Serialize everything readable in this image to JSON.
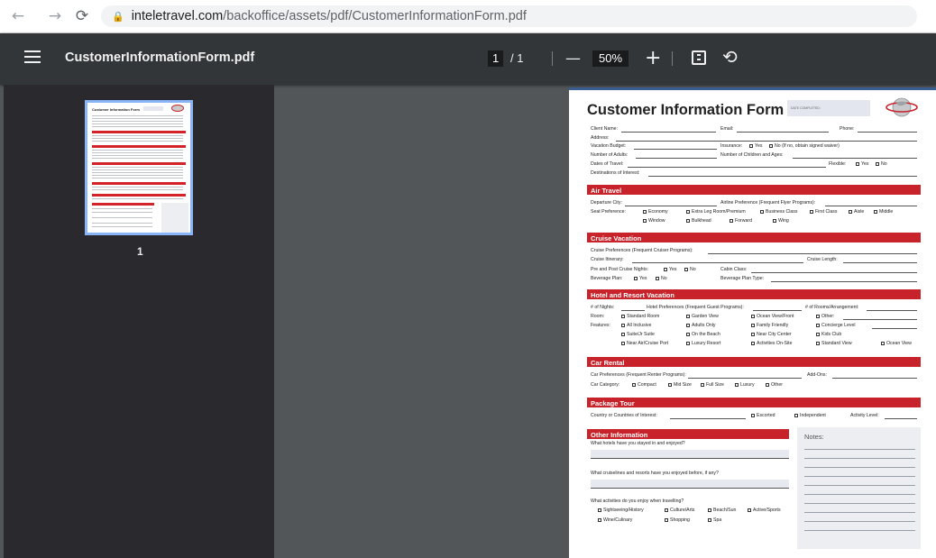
{
  "browser": {
    "url_host": "inteletravel.com",
    "url_path": "/backoffice/assets/pdf/CustomerInformationForm.pdf"
  },
  "toolbar": {
    "filename": "CustomerInformationForm.pdf",
    "page_current": "1",
    "page_total": "/ 1",
    "zoom": "50%",
    "zoom_out": "—",
    "zoom_in": "+"
  },
  "thumbnails": [
    {
      "label": "1"
    }
  ],
  "form": {
    "title": "Customer Information Form",
    "date_completed": "DATE COMPLETED:",
    "client_name": "Client Name:",
    "email": "Email:",
    "phone": "Phone:",
    "address": "Address:",
    "vacation_budget": "Vacation Budget:",
    "insurance": "Insurance:",
    "insurance_yes": "Yes",
    "insurance_no": "No (If no, obtain signed waiver)",
    "adults": "Number of Adults:",
    "children": "Number of Children and Ages:",
    "dates": "Dates of Travel:",
    "flexible": "Flexible:",
    "flex_yes": "Yes",
    "flex_no": "No",
    "destinations": "Destinations of Interest:",
    "air": {
      "title": "Air Travel",
      "departure": "Departure City:",
      "airline_pref": "Airline Preference (Frequent Flyer Programs):",
      "seat": "Seat Preference:",
      "opts1": [
        "Economy",
        "Extra Leg Room/Premium",
        "Business Class",
        "First Class",
        "Aisle",
        "Middle"
      ],
      "opts2": [
        "Window",
        "Bulkhead",
        "Forward",
        "Wing"
      ]
    },
    "cruise": {
      "title": "Cruise Vacation",
      "pref": "Cruise Preferences (Frequent Cruiser Programs):",
      "itinerary": "Cruise Itinerary:",
      "length": "Cruise Length:",
      "prepost": "Pre and Post Cruise Nights:",
      "yes": "Yes",
      "no": "No",
      "cabin": "Cabin Class:",
      "beverage": "Beverage Plan:",
      "bev_type": "Beverage Plan Type:"
    },
    "hotel": {
      "title": "Hotel and Resort Vacation",
      "nights": "# of Nights:",
      "pref": "Hotel Preferences (Frequent Guest Programs):",
      "rooms": "# of Rooms/Arrangement:",
      "room": "Room:",
      "room_opts": [
        "Standard Room",
        "Garden View",
        "Ocean View/Front",
        "Other:"
      ],
      "features": "Features:",
      "f1": [
        "All Inclusive",
        "Adults Only",
        "Family Friendly",
        "Concierge Level"
      ],
      "f2": [
        "Suite/Jr Suite",
        "On the Beach",
        "Near City Center",
        "Kids Club"
      ],
      "f3": [
        "Near Air/Cruise Port",
        "Luxury Resort",
        "Activities On-Site",
        "Standard View",
        "Ocean View"
      ]
    },
    "car": {
      "title": "Car Rental",
      "pref": "Car Preferences (Frequent Renter Programs):",
      "addons": "Add-Ons:",
      "category": "Car Category:",
      "opts": [
        "Compact",
        "Mid Size",
        "Full Size",
        "Luxury",
        "Other"
      ]
    },
    "package": {
      "title": "Package Tour",
      "country": "Country or Countries of Interest:",
      "escorted": "Escorted",
      "independent": "Independent",
      "activity": "Activity Level:"
    },
    "other": {
      "title": "Other Information",
      "q1": "What hotels have you stayed in and enjoyed?",
      "q2": "What cruiselines and resorts have you enjoyed before, if any?",
      "q3": "What activities do you enjoy when travelling?",
      "a1": [
        "Sightseeing/History",
        "Culture/Arts",
        "Beach/Sun",
        "Active/Sports"
      ],
      "a2": [
        "Wine/Culinary",
        "Shopping",
        "Spa"
      ]
    },
    "notes": "Notes:"
  },
  "colors": {
    "accent_red": "#c8232a",
    "toolbar_bg": "#323639",
    "viewer_bg": "#525659",
    "thumb_border": "#8ab4f8"
  }
}
